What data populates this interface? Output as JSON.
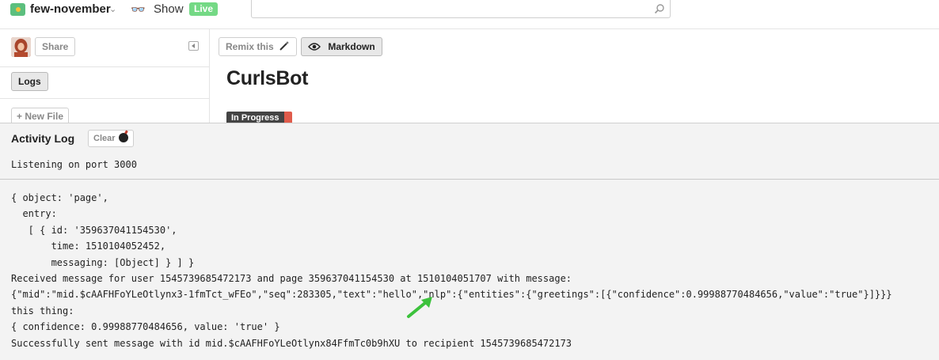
{
  "topbar": {
    "project_name": "few-november",
    "show_label": "Show",
    "live_label": "Live",
    "search_placeholder": ""
  },
  "sidebar": {
    "share_label": "Share",
    "logs_label": "Logs",
    "new_file_label": "+ New File"
  },
  "editor": {
    "remix_label": "Remix this",
    "markdown_label": "Markdown",
    "title": "CurlsBot",
    "status_badge": "In Progress"
  },
  "activity_log": {
    "title": "Activity Log",
    "clear_label": "Clear",
    "first_line": "Listening on port 3000",
    "lines": [
      "{ object: 'page',",
      "  entry:",
      "   [ { id: '359637041154530',",
      "       time: 1510104052452,",
      "       messaging: [Object] } ] }",
      "Received message for user 1545739685472173 and page 359637041154530 at 1510104051707 with message:",
      "{\"mid\":\"mid.$cAAFHFoYLeOtlynx3-1fmTct_wFEo\",\"seq\":283305,\"text\":\"hello\",\"nlp\":{\"entities\":{\"greetings\":[{\"confidence\":0.99988770484656,\"value\":\"true\"}]}}}",
      "this thing:",
      "{ confidence: 0.99988770484656, value: 'true' }",
      "Successfully sent message with id mid.$cAAFHFoYLeOtlynx84FfmTc0b9hXU to recipient 1545739685472173"
    ]
  },
  "colors": {
    "live_badge": "#74d985",
    "status_badge_accent": "#e05b4b",
    "annotation_arrow": "#3cc23c"
  },
  "icons": {
    "project_logo": "project-logo-icon",
    "show": "glasses-icon",
    "search": "search-icon",
    "collapse": "collapse-sidebar-icon",
    "remix": "magic-wand-icon",
    "markdown": "eye-icon",
    "clear": "bomb-icon",
    "annotation": "green-arrow-icon"
  }
}
